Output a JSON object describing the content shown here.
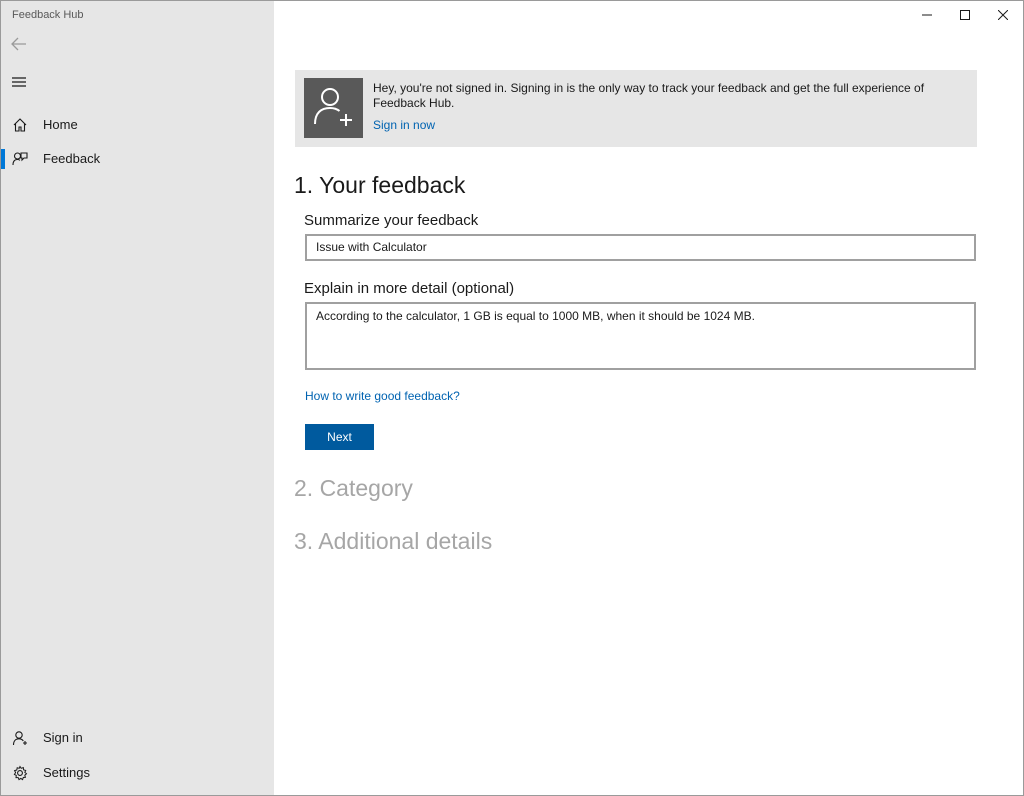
{
  "window": {
    "title": "Feedback Hub",
    "icons": [
      "minimize-icon",
      "maximize-icon",
      "close-icon"
    ]
  },
  "sidebar": {
    "back_icon": "back-arrow-icon",
    "menu_icon": "hamburger-icon",
    "items": [
      {
        "label": "Home",
        "icon": "home-icon",
        "selected": false
      },
      {
        "label": "Feedback",
        "icon": "feedback-icon",
        "selected": true
      }
    ],
    "footer_items": [
      {
        "label": "Sign in",
        "icon": "person-icon"
      },
      {
        "label": "Settings",
        "icon": "gear-icon"
      }
    ],
    "accent_color": "#0078d7"
  },
  "banner": {
    "text": "Hey, you're not signed in. Signing in is the only way to track your feedback and get the full experience of Feedback Hub.",
    "link": "Sign in now",
    "icon": "add-user-icon"
  },
  "main": {
    "step1_heading": "1. Your feedback",
    "summary_label": "Summarize your feedback",
    "summary_value": "Issue with Calculator",
    "detail_label": "Explain in more detail (optional)",
    "detail_value": "According to the calculator, 1 GB is equal to 1000 MB, when it should be 1024 MB.",
    "help_link": "How to write good feedback?",
    "next_button": "Next",
    "step2_heading": "2. Category",
    "step3_heading": "3. Additional details"
  },
  "colors": {
    "link": "#0063b1",
    "button": "#005a9e",
    "disabled_heading": "#a6a6a6"
  }
}
